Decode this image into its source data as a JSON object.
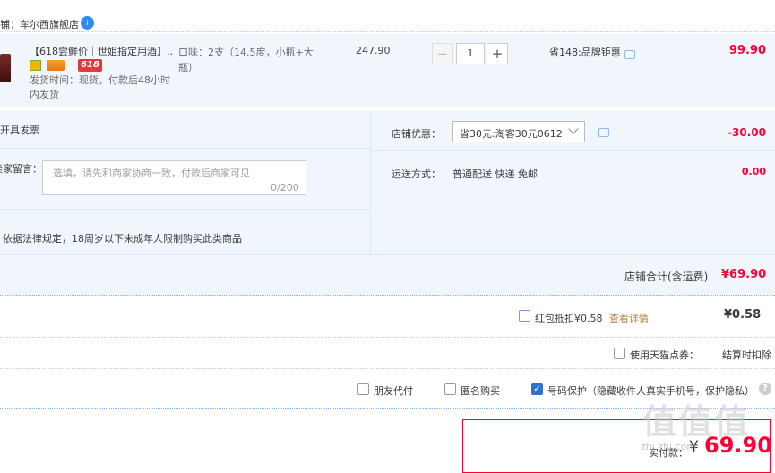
{
  "store": {
    "name": "铺：车尔西旗舰店",
    "badge": "i"
  },
  "item": {
    "title": "【618尝鲜价｜世姐指定用酒】...",
    "promo_badge": "618",
    "ship_time": "发货时间：现货，付款后48小时内发货",
    "sku": "口味：2支（14.5度，小瓶+大瓶）",
    "unit_price": "247.90",
    "quantity": "1",
    "minus": "−",
    "plus": "+",
    "discount": "省148:品牌钜惠",
    "total": "99.90"
  },
  "options": {
    "invoice_label": "开具发票",
    "message_label": "卖家留言：",
    "message_placeholder": "选填，请先和商家协商一致，付款后商家可见",
    "message_count": "0/200",
    "legal_notice": "依据法律规定，18周岁以下未成年人限制购买此类商品",
    "store_coupon_label": "店铺优惠：",
    "store_coupon_value": "省30元:淘客30元0612",
    "store_coupon_amount": "-30.00",
    "shipping_label": "运送方式：",
    "shipping_value": "普通配送 快递 免邮",
    "shipping_amount": "0.00"
  },
  "store_total": {
    "label": "店铺合计(含运费)",
    "value": "¥69.90"
  },
  "red_packet": {
    "label": "红包抵扣¥0.58",
    "link": "查看详情",
    "value": "¥0.58"
  },
  "tmall_points": {
    "label": "使用天猫点券：",
    "note": "结算时扣除"
  },
  "extras": {
    "friend_pay": "朋友代付",
    "anonymous": "匿名购买",
    "number_protect": "号码保护（隐藏收件人真实手机号，保护隐私）",
    "help": "?"
  },
  "payment": {
    "label": "实付款：",
    "yen": "¥",
    "value": "69.90"
  },
  "watermark": {
    "text": "值值值",
    "sub": "zhi.zhi.com"
  },
  "colors": {
    "accent_red": "#ff0036",
    "light_blue_bg": "#f1f6fd",
    "checkbox_blue": "#2f71ce"
  }
}
